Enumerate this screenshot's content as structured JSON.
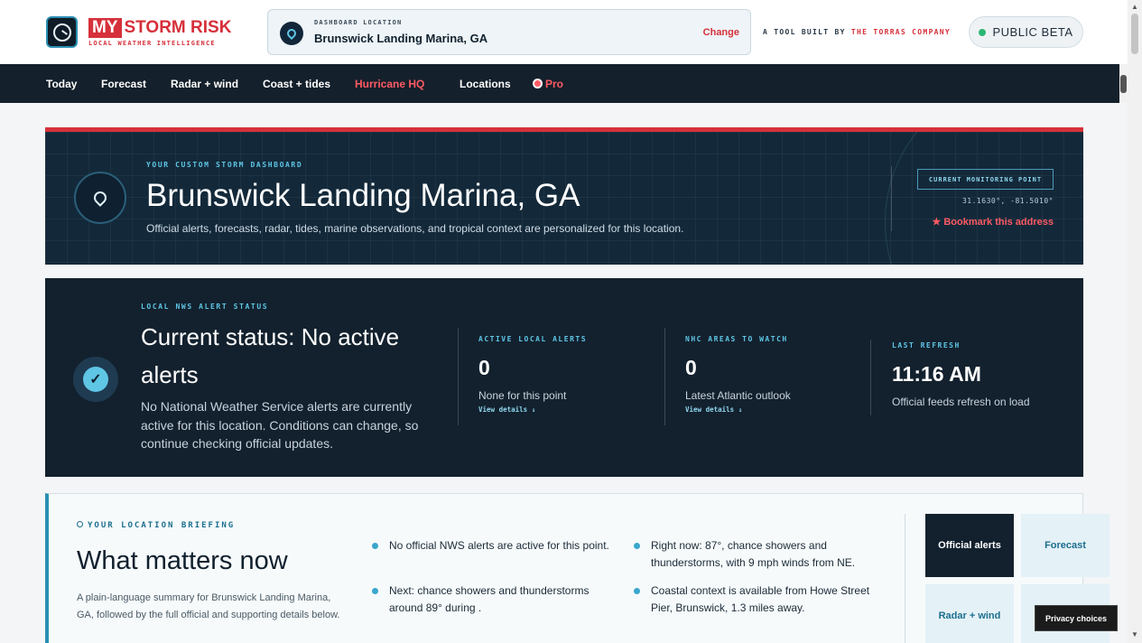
{
  "header": {
    "brand_my": "MY",
    "brand_storm": "STORM RISK",
    "brand_tagline": "LOCAL WEATHER INTELLIGENCE",
    "location_label": "DASHBOARD LOCATION",
    "location_value": "Brunswick Landing Marina, GA",
    "change_label": "Change",
    "built_by_prefix": "A TOOL BUILT BY",
    "built_by_company": "THE TORRAS COMPANY",
    "beta_label": "PUBLIC BETA",
    "logo_icon": "radar-gauge-icon"
  },
  "nav": {
    "items": [
      "Today",
      "Forecast",
      "Radar + wind",
      "Coast + tides",
      "Hurricane HQ",
      "Locations",
      "Pro"
    ]
  },
  "hero": {
    "kicker": "YOUR CUSTOM STORM DASHBOARD",
    "title": "Brunswick Landing Marina, GA",
    "description": "Official alerts, forecasts, radar, tides, marine observations, and tropical context are personalized for this location.",
    "monitor_label": "CURRENT MONITORING POINT",
    "coords": "31.1630°, -81.5010°",
    "bookmark": "★ Bookmark this address"
  },
  "status": {
    "kicker": "LOCAL NWS ALERT STATUS",
    "headline": "Current status: No active alerts",
    "paragraph": "No National Weather Service alerts are currently active for this location. Conditions can change, so continue checking official updates.",
    "metrics": [
      {
        "label": "ACTIVE LOCAL ALERTS",
        "value": "0",
        "sub": "None for this point",
        "link": "View details ↓"
      },
      {
        "label": "NHC AREAS TO WATCH",
        "value": "0",
        "sub": "Latest Atlantic outlook",
        "link": "View details ↓"
      },
      {
        "label": "LAST REFRESH",
        "value": "11:16 AM",
        "sub": "Official feeds refresh on load"
      }
    ]
  },
  "briefing": {
    "kicker": "YOUR LOCATION BRIEFING",
    "title": "What matters now",
    "summary": "A plain-language summary for Brunswick Landing Marina, GA, followed by the full official and supporting details below.",
    "bullets": [
      "No official NWS alerts are active for this point.",
      "Right now: 87°, chance showers and thunderstorms, with 9 mph winds from NE.",
      "Next: chance showers and thunderstorms around 89° during .",
      "Coastal context is available from Howe Street Pier, Brunswick, 1.3 miles away."
    ],
    "quick_links": [
      "Official alerts",
      "Forecast",
      "Radar + wind",
      ""
    ]
  },
  "privacy_label": "Privacy choices",
  "colors": {
    "accent_red": "#d6303a",
    "navy": "#13212e",
    "cyan": "#5fc6e6",
    "green_dot": "#2bb673"
  }
}
